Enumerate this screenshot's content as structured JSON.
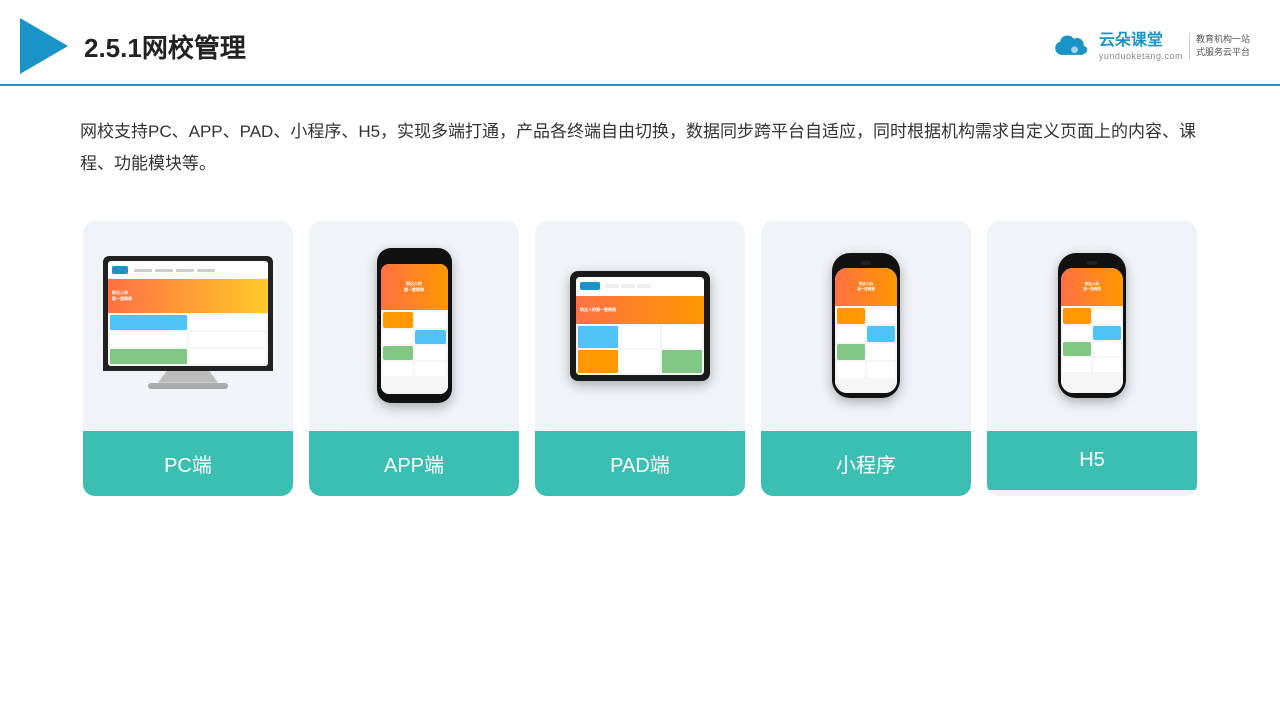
{
  "header": {
    "title": "2.5.1网校管理",
    "brand_name": "云朵课堂",
    "brand_url": "yunduoketang.com",
    "brand_slogan": "教育机构一站\n式服务云平台"
  },
  "description": "网校支持PC、APP、PAD、小程序、H5，实现多端打通，产品各终端自由切换，数据同步跨平台自适应，同时根据机构需求自定义页面上的内容、课程、功能模块等。",
  "cards": [
    {
      "id": "pc",
      "label": "PC端"
    },
    {
      "id": "app",
      "label": "APP端"
    },
    {
      "id": "pad",
      "label": "PAD端"
    },
    {
      "id": "miniprogram",
      "label": "小程序"
    },
    {
      "id": "h5",
      "label": "H5"
    }
  ],
  "colors": {
    "accent": "#1a94c8",
    "teal": "#3bbfb2",
    "border": "#1a94c8"
  }
}
